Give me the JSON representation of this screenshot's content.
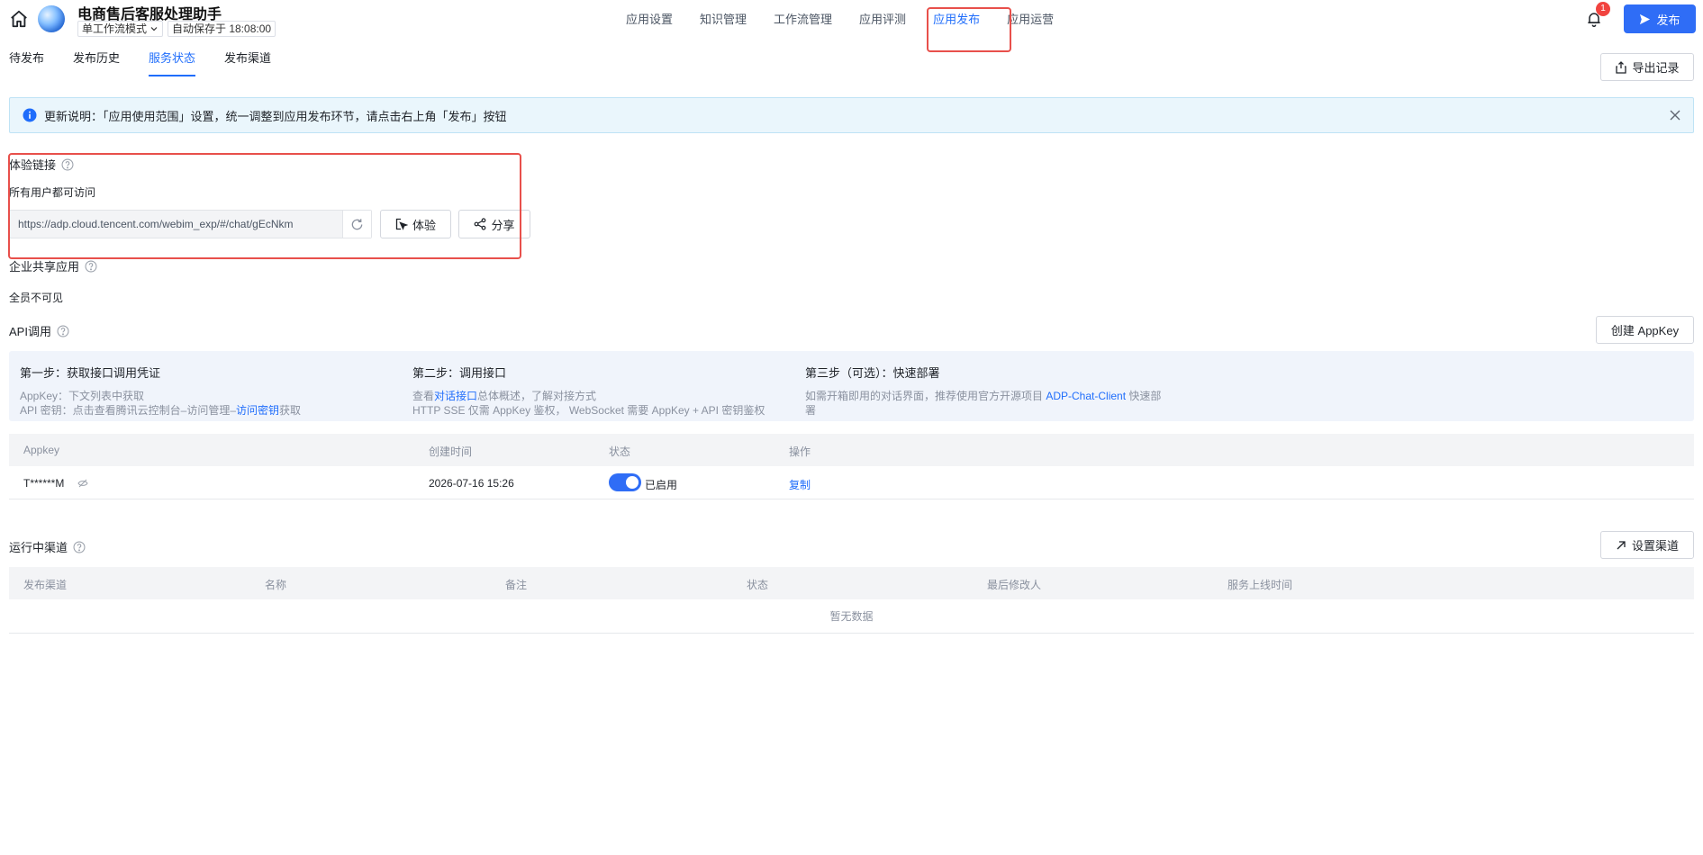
{
  "header": {
    "app_title": "电商售后客服处理助手",
    "mode_select": "单工作流模式",
    "autosave": "自动保存于 18:08:00",
    "nav": [
      {
        "label": "应用设置"
      },
      {
        "label": "知识管理"
      },
      {
        "label": "工作流管理"
      },
      {
        "label": "应用评测"
      },
      {
        "label": "应用发布",
        "active": true
      },
      {
        "label": "应用运营"
      }
    ],
    "notification_count": "1",
    "publish_label": "发布",
    "accent_color": "#2f6df6",
    "highlight_color": "#e8504b"
  },
  "subtabs": [
    {
      "label": "待发布"
    },
    {
      "label": "发布历史"
    },
    {
      "label": "服务状态",
      "active": true
    },
    {
      "label": "发布渠道"
    }
  ],
  "export_label": "导出记录",
  "notice": {
    "text": "更新说明：「应用使用范围」设置，统一调整到应用发布环节，请点击右上角「发布」按钮"
  },
  "experience": {
    "title": "体验链接",
    "access": "所有用户都可访问",
    "url": "https://adp.cloud.tencent.com/webim_exp/#/chat/gEcNkm",
    "try_label": "体验",
    "share_label": "分享"
  },
  "enterprise": {
    "title": "企业共享应用",
    "visibility": "全员不可见"
  },
  "api": {
    "title": "API调用",
    "create_key_label": "创建 AppKey",
    "steps": [
      {
        "title": "第一步：获取接口调用凭证",
        "line1": "AppKey：下文列表中获取",
        "line2_pre": "API 密钥：点击查看腾讯云控制台–访问管理–",
        "line2_link": "访问密钥",
        "line2_post": "获取"
      },
      {
        "title": "第二步：调用接口",
        "line1_pre": "查看",
        "line1_link": "对话接口",
        "line1_post": "总体概述，了解对接方式",
        "line2": "HTTP SSE 仅需 AppKey 鉴权， WebSocket 需要 AppKey + API 密钥鉴权"
      },
      {
        "title": "第三步（可选）：快速部署",
        "line1_pre": "如需开箱即用的对话界面，推荐使用官方开源项目 ",
        "line1_link": "ADP-Chat-Client",
        "line1_post": " 快速部",
        "line2": "署"
      }
    ],
    "columns": [
      "Appkey",
      "创建时间",
      "状态",
      "操作"
    ],
    "rows": [
      {
        "appkey": "T******M",
        "created": "2026-07-16 15:26",
        "status": "已启用",
        "action": "复制"
      }
    ]
  },
  "channels": {
    "title": "运行中渠道",
    "setup_label": "设置渠道",
    "columns": [
      "发布渠道",
      "名称",
      "备注",
      "状态",
      "最后修改人",
      "服务上线时间"
    ],
    "empty": "暂无数据"
  }
}
